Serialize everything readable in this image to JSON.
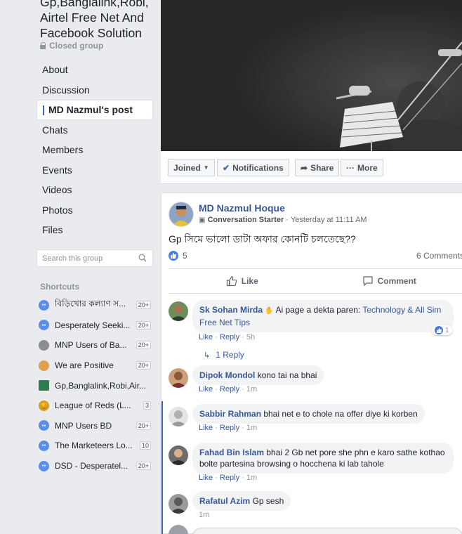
{
  "group": {
    "title": "Gp,Banglalink,Robi, Airtel Free Net And Facebook Solution",
    "privacy": "Closed group"
  },
  "nav": [
    {
      "label": "About"
    },
    {
      "label": "Discussion"
    },
    {
      "label": "MD Nazmul's post",
      "active": true
    },
    {
      "label": "Chats"
    },
    {
      "label": "Members"
    },
    {
      "label": "Events"
    },
    {
      "label": "Videos"
    },
    {
      "label": "Photos"
    },
    {
      "label": "Files"
    }
  ],
  "search": {
    "placeholder": "Search this group"
  },
  "shortcuts": {
    "heading": "Shortcuts",
    "items": [
      {
        "label": "বিড়িখোর কল্যাণ স...",
        "count": "20+",
        "icon": "group-icon",
        "color": "#5b8def"
      },
      {
        "label": "Desperately Seeki...",
        "count": "20+",
        "icon": "group-icon",
        "color": "#5b8def"
      },
      {
        "label": "MNP Users of Ba...",
        "count": "20+",
        "icon": "megaphone-icon",
        "color": "#8a8d91"
      },
      {
        "label": "We are Positive",
        "count": "20+",
        "icon": "rock-hand-icon",
        "color": "#e0a050"
      },
      {
        "label": "Gp,Banglalink,Robi,Air...",
        "count": "",
        "icon": "group-photo-icon",
        "color": "#2e7d4f"
      },
      {
        "label": "League of Reds (L...",
        "count": "3",
        "icon": "trophy-icon",
        "color": "#d4a017"
      },
      {
        "label": "MNP Users BD",
        "count": "20+",
        "icon": "group-icon",
        "color": "#5b8def"
      },
      {
        "label": "The Marketeers Lo...",
        "count": "10",
        "icon": "group-icon",
        "color": "#5b8def"
      },
      {
        "label": "DSD - Desperatel...",
        "count": "20+",
        "icon": "group-icon",
        "color": "#5b8def"
      }
    ]
  },
  "cover_actions": {
    "joined": "Joined",
    "notifications": "Notifications",
    "share": "Share",
    "more": "More"
  },
  "post": {
    "author": "MD Nazmul Hoque",
    "badge": "Conversation Starter",
    "time": "Yesterday at 11:11 AM",
    "text": "Gp সিমে ভালো ডাটা অফার কোনটি চলতেছে??",
    "like_count": "5",
    "comment_count": "6 Comments",
    "like_label": "Like",
    "comment_label": "Comment"
  },
  "comments": [
    {
      "name": "Sk Sohan Mirda",
      "text": "Ai page a dekta paren: ",
      "link": "Technology & All Sim Free Net Tips",
      "like": "Like",
      "reply": "Reply",
      "time": "5h",
      "reactions": "1",
      "replies": "1 Reply"
    },
    {
      "name": "Dipok Mondol",
      "text": "kono tai na bhai",
      "like": "Like",
      "reply": "Reply",
      "time": "1m"
    },
    {
      "name": "Sabbir Rahman",
      "text": "bhai net e to chole na offer diye ki korben",
      "like": "Like",
      "reply": "Reply",
      "time": "1m"
    },
    {
      "name": "Fahad Bin Islam",
      "text": "bhai 2 Gb net pore she phn e karo sathe kothao bolte partesina browsing o hocchena ki lab tahole",
      "like": "Like",
      "reply": "Reply",
      "time": "1m"
    },
    {
      "name": "Rafatul Azim",
      "text": "Gp sesh",
      "time": "1m"
    }
  ]
}
